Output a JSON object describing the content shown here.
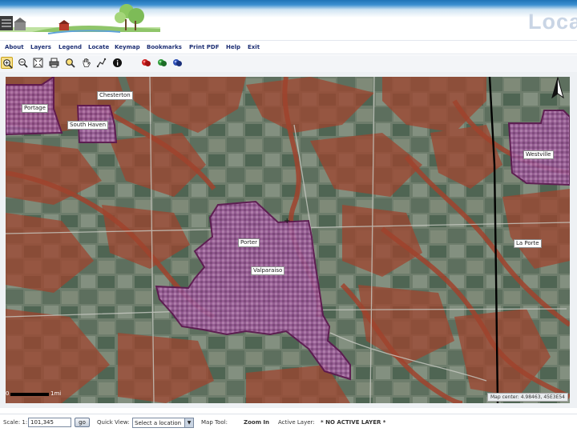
{
  "header": {
    "logo_text": "Loca"
  },
  "menu": {
    "items": [
      {
        "label": "About"
      },
      {
        "label": "Layers"
      },
      {
        "label": "Legend"
      },
      {
        "label": "Locate"
      },
      {
        "label": "Keymap"
      },
      {
        "label": "Bookmarks"
      },
      {
        "label": "Print PDF"
      },
      {
        "label": "Help"
      },
      {
        "label": "Exit"
      }
    ]
  },
  "toolbar": {
    "tools": [
      {
        "icon": "zoom-in-icon",
        "active": true
      },
      {
        "icon": "zoom-out-icon"
      },
      {
        "icon": "full-extent-icon"
      },
      {
        "icon": "print-icon"
      },
      {
        "icon": "zoom-to-selection-icon"
      },
      {
        "icon": "pan-hand-icon"
      },
      {
        "icon": "measure-icon"
      },
      {
        "icon": "identify-icon"
      },
      {
        "icon": "clear-selection-red-icon"
      },
      {
        "icon": "select-green-icon"
      },
      {
        "icon": "select-blue-icon"
      }
    ]
  },
  "map": {
    "labels": {
      "chesterton": "Chesterton",
      "porter": "Porter",
      "south_haven": "South Haven",
      "valparaiso": "Valparaiso",
      "portage": "Portage",
      "westville": "Westville",
      "laporte": "La Porte"
    },
    "scale_left": "0",
    "scale_right": "1mi",
    "map_center": "Map center: 4.98463, 45E3E54",
    "colors": {
      "overlay": "#a0432d",
      "city": "#8e4a8f",
      "city_outline": "#5c1550"
    }
  },
  "status": {
    "scale_label": "Scale: 1:",
    "scale_value": "101,345",
    "go_label": "go",
    "quick_view_label": "Quick View:",
    "quick_view_selected": "Select a location",
    "map_tool_label": "Map Tool:",
    "map_tool_value": "Zoom In",
    "active_layer_label": "Active Layer:",
    "active_layer_value": "* NO ACTIVE LAYER *"
  }
}
